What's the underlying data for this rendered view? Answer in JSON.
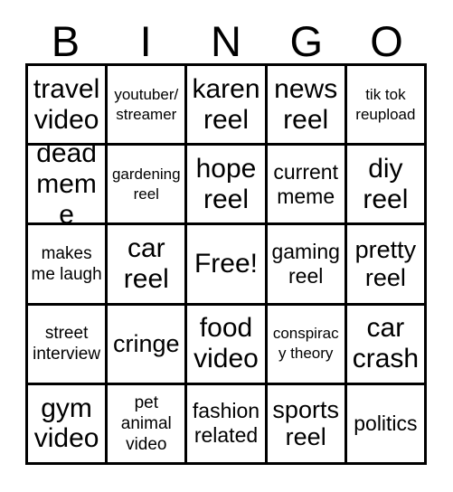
{
  "card": {
    "header_letters": [
      "B",
      "I",
      "N",
      "G",
      "O"
    ],
    "columns": 5,
    "rows": 5,
    "border_color": "#000000",
    "background_color": "#ffffff",
    "text_color": "#000000",
    "free_space_label": "Free!",
    "free_space_position": "N3",
    "cells": [
      {
        "label": "travel video",
        "column": "B",
        "row": 1,
        "size": "xl"
      },
      {
        "label": "youtuber/ streamer",
        "column": "I",
        "row": 1,
        "size": "xs"
      },
      {
        "label": "karen reel",
        "column": "N",
        "row": 1,
        "size": "xl"
      },
      {
        "label": "news reel",
        "column": "G",
        "row": 1,
        "size": "xl"
      },
      {
        "label": "tik tok reupload",
        "column": "O",
        "row": 1,
        "size": "xs"
      },
      {
        "label": "dead meme",
        "column": "B",
        "row": 2,
        "size": "xl"
      },
      {
        "label": "gardening reel",
        "column": "I",
        "row": 2,
        "size": "xs"
      },
      {
        "label": "hope reel",
        "column": "N",
        "row": 2,
        "size": "xl"
      },
      {
        "label": "current meme",
        "column": "G",
        "row": 2,
        "size": "md"
      },
      {
        "label": "diy reel",
        "column": "O",
        "row": 2,
        "size": "xl"
      },
      {
        "label": "makes me laugh",
        "column": "B",
        "row": 3,
        "size": "sm"
      },
      {
        "label": "car reel",
        "column": "I",
        "row": 3,
        "size": "xl"
      },
      {
        "label": "Free!",
        "column": "N",
        "row": 3,
        "size": "xl"
      },
      {
        "label": "gaming reel",
        "column": "G",
        "row": 3,
        "size": "md"
      },
      {
        "label": "pretty reel",
        "column": "O",
        "row": 3,
        "size": "lg"
      },
      {
        "label": "street interview",
        "column": "B",
        "row": 4,
        "size": "sm"
      },
      {
        "label": "cringe",
        "column": "I",
        "row": 4,
        "size": "lg"
      },
      {
        "label": "food video",
        "column": "N",
        "row": 4,
        "size": "xl"
      },
      {
        "label": "conspiracy theory",
        "column": "G",
        "row": 4,
        "size": "xs"
      },
      {
        "label": "car crash",
        "column": "O",
        "row": 4,
        "size": "xl"
      },
      {
        "label": "gym video",
        "column": "B",
        "row": 5,
        "size": "xl"
      },
      {
        "label": "pet animal video",
        "column": "I",
        "row": 5,
        "size": "sm"
      },
      {
        "label": "fashion related",
        "column": "N",
        "row": 5,
        "size": "md"
      },
      {
        "label": "sports reel",
        "column": "G",
        "row": 5,
        "size": "lg"
      },
      {
        "label": "politics",
        "column": "O",
        "row": 5,
        "size": "md"
      }
    ]
  }
}
